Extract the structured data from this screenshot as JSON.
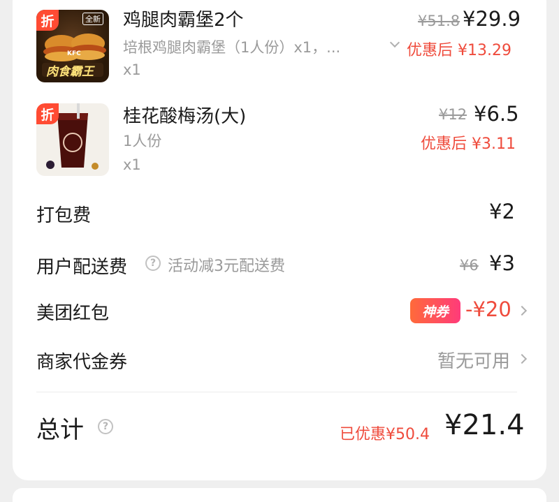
{
  "items": [
    {
      "badge": "折",
      "name": "鸡腿肉霸堡2个",
      "spec": "培根鸡腿肉霸堡（1人份）x1，...",
      "qty": "x1",
      "original_price": "¥51.8",
      "price": "¥29.9",
      "discounted_label": "优惠后 ¥13.29",
      "image_text": {
        "tag": "全新",
        "brand": "KFC",
        "title": "肉食霸王"
      }
    },
    {
      "badge": "折",
      "name": "桂花酸梅汤(大)",
      "spec": "1人份",
      "qty": "x1",
      "original_price": "¥12",
      "price": "¥6.5",
      "discounted_label": "优惠后 ¥3.11"
    }
  ],
  "fees": {
    "packing_label": "打包费",
    "packing_price": "¥2",
    "delivery_label": "用户配送费",
    "delivery_note": "活动减3元配送费",
    "delivery_original": "¥6",
    "delivery_price": "¥3"
  },
  "redpacket": {
    "label": "美团红包",
    "tag": "神券",
    "amount": "-¥20"
  },
  "voucher": {
    "label": "商家代金券",
    "status": "暂无可用"
  },
  "total": {
    "label": "总计",
    "saved": "已优惠¥50.4",
    "amount": "¥21.4"
  },
  "colors": {
    "accent_red": "#ef4b3c",
    "badge_red": "#ff4b33",
    "muted": "#9a9a9a"
  }
}
